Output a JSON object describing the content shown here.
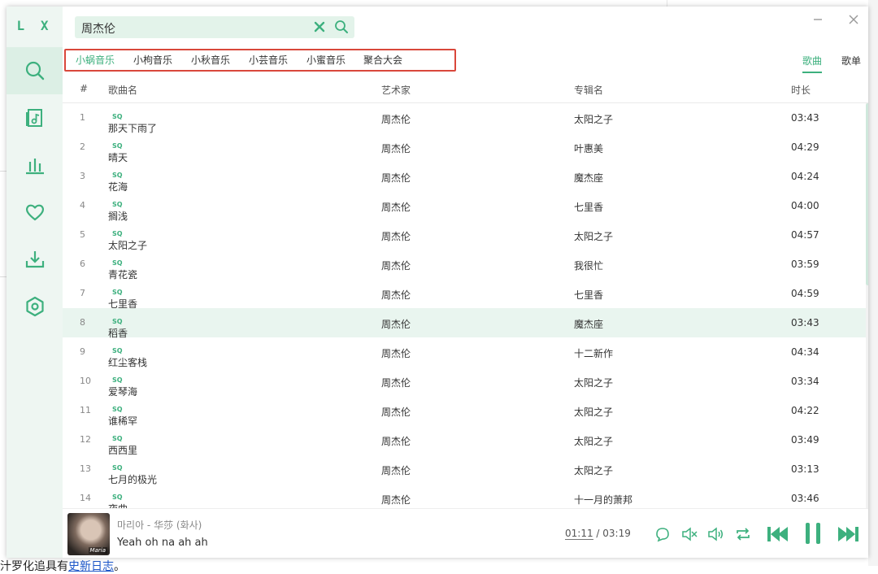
{
  "app": {
    "logo": "L X"
  },
  "search": {
    "value": "周杰伦"
  },
  "sources": [
    {
      "label": "小蜗音乐",
      "active": true
    },
    {
      "label": "小枸音乐",
      "active": false
    },
    {
      "label": "小秋音乐",
      "active": false
    },
    {
      "label": "小芸音乐",
      "active": false
    },
    {
      "label": "小蜜音乐",
      "active": false
    },
    {
      "label": "聚合大会",
      "active": false
    }
  ],
  "result_types": [
    {
      "label": "歌曲",
      "active": true
    },
    {
      "label": "歌单",
      "active": false
    }
  ],
  "table": {
    "columns": [
      "#",
      "歌曲名",
      "艺术家",
      "专辑名",
      "时长"
    ],
    "rows": [
      {
        "num": "1",
        "title": "那天下雨了",
        "badge": "SQ",
        "artist": "周杰伦",
        "album": "太阳之子",
        "duration": "03:43"
      },
      {
        "num": "2",
        "title": "晴天",
        "badge": "SQ",
        "artist": "周杰伦",
        "album": "叶惠美",
        "duration": "04:29"
      },
      {
        "num": "3",
        "title": "花海",
        "badge": "SQ",
        "artist": "周杰伦",
        "album": "魔杰座",
        "duration": "04:24"
      },
      {
        "num": "4",
        "title": "搁浅",
        "badge": "SQ",
        "artist": "周杰伦",
        "album": "七里香",
        "duration": "04:00"
      },
      {
        "num": "5",
        "title": "太阳之子",
        "badge": "SQ",
        "artist": "周杰伦",
        "album": "太阳之子",
        "duration": "04:57"
      },
      {
        "num": "6",
        "title": "青花瓷",
        "badge": "SQ",
        "artist": "周杰伦",
        "album": "我很忙",
        "duration": "03:59"
      },
      {
        "num": "7",
        "title": "七里香",
        "badge": "SQ",
        "artist": "周杰伦",
        "album": "七里香",
        "duration": "04:59"
      },
      {
        "num": "8",
        "title": "稻香",
        "badge": "SQ",
        "artist": "周杰伦",
        "album": "魔杰座",
        "duration": "03:43"
      },
      {
        "num": "9",
        "title": "红尘客栈",
        "badge": "SQ",
        "artist": "周杰伦",
        "album": "十二新作",
        "duration": "04:34"
      },
      {
        "num": "10",
        "title": "爱琴海",
        "badge": "SQ",
        "artist": "周杰伦",
        "album": "太阳之子",
        "duration": "03:34"
      },
      {
        "num": "11",
        "title": "谁稀罕",
        "badge": "SQ",
        "artist": "周杰伦",
        "album": "太阳之子",
        "duration": "04:22"
      },
      {
        "num": "12",
        "title": "西西里",
        "badge": "SQ",
        "artist": "周杰伦",
        "album": "太阳之子",
        "duration": "03:49"
      },
      {
        "num": "13",
        "title": "七月的极光",
        "badge": "SQ",
        "artist": "周杰伦",
        "album": "太阳之子",
        "duration": "03:13"
      },
      {
        "num": "14",
        "title": "夜曲",
        "badge": "SQ",
        "artist": "周杰伦",
        "album": "十一月的萧邦",
        "duration": "03:46"
      }
    ],
    "selected_row": "8"
  },
  "player": {
    "cover_label": "Maria",
    "track": "마리아 - 华莎 (화사)",
    "lyric": "Yeah oh na ah ah",
    "current_time": "01:11",
    "separator": " / ",
    "total_time": "03:19"
  },
  "background": {
    "bottom_prefix": "汁罗化追具有",
    "bottom_link": "史新日志",
    "bottom_suffix": "。"
  },
  "colors": {
    "accent": "#3db07e",
    "sidebar": "#eef6f2",
    "highlight_box": "#d9473b"
  },
  "icons": [
    "search-icon",
    "music-file-icon",
    "chart-icon",
    "heart-icon",
    "download-icon",
    "settings-icon",
    "clear-icon",
    "minimize-icon",
    "close-icon",
    "loop-comment-icon",
    "lyrics-off-icon",
    "volume-icon",
    "repeat-icon",
    "previous-icon",
    "pause-icon",
    "next-icon"
  ]
}
